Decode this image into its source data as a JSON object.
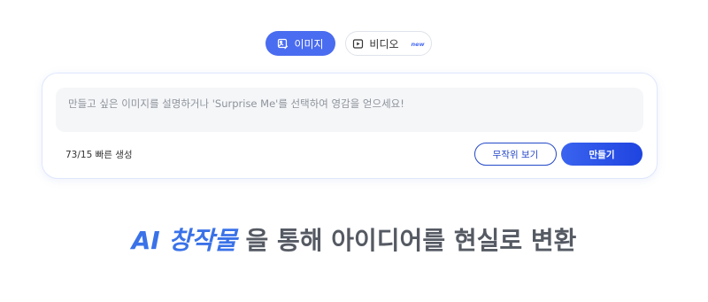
{
  "tabs": {
    "image": {
      "label": "이미지",
      "icon": "image-edit-icon"
    },
    "video": {
      "label": "비디오",
      "icon": "video-play-icon",
      "badge": "new"
    }
  },
  "prompt": {
    "placeholder": "만들고 싶은 이미지를 설명하거나 'Surprise Me'를 선택하여 영감을 얻으세요!",
    "value": ""
  },
  "usage": {
    "text": "73/15 빠른 생성"
  },
  "buttons": {
    "random": "무작위 보기",
    "create": "만들기"
  },
  "headline": {
    "accent": "AI 창작물",
    "rest": " 을 통해 아이디어를 현실로 변환"
  },
  "colors": {
    "accent": "#4a6cf0",
    "primary_button": "#2448c8",
    "headline_accent": "#3a72e8",
    "headline_text": "#555a63"
  }
}
